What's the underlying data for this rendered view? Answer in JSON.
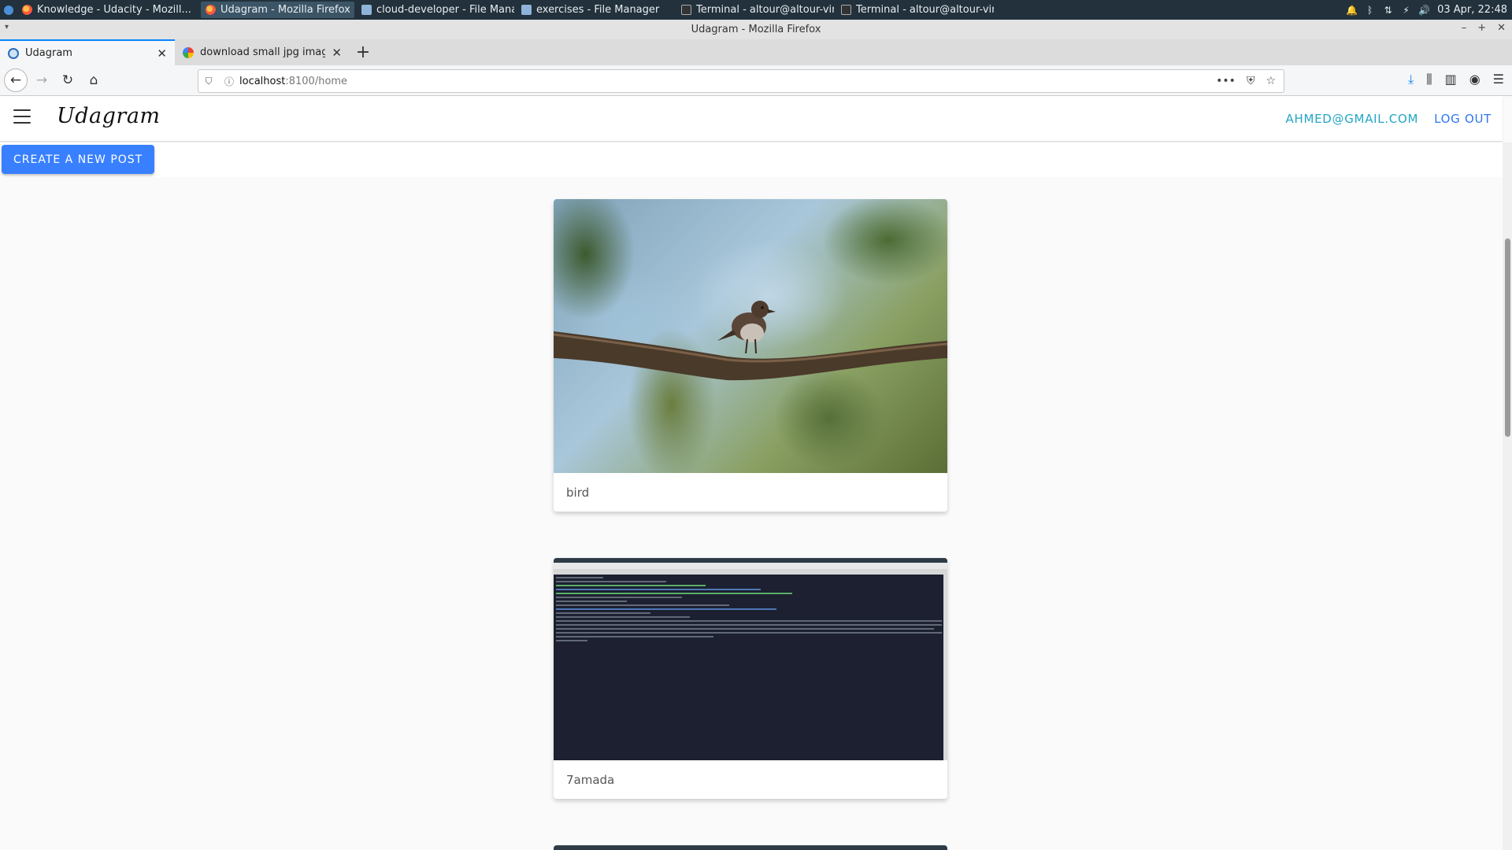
{
  "taskbar": {
    "tasks": [
      {
        "label": "Knowledge - Udacity - Mozill...",
        "icon": "firefox-icon"
      },
      {
        "label": "Udagram - Mozilla Firefox",
        "icon": "firefox-icon"
      },
      {
        "label": "cloud-developer - File Manag...",
        "icon": "folder-icon"
      },
      {
        "label": "exercises - File Manager",
        "icon": "folder-icon"
      },
      {
        "label": "Terminal - altour@altour-virt...",
        "icon": "terminal-icon"
      },
      {
        "label": "Terminal - altour@altour-virt...",
        "icon": "terminal-icon"
      }
    ],
    "clock": "03 Apr, 22:48"
  },
  "window": {
    "title": "Udagram - Mozilla Firefox"
  },
  "browser": {
    "tabs": [
      {
        "label": "Udagram",
        "selected": true
      },
      {
        "label": "download small jpg image - G",
        "selected": false
      }
    ],
    "url_host": "localhost",
    "url_path": ":8100/home"
  },
  "app": {
    "brand": "Udagram",
    "user_email": "AHMED@GMAIL.COM",
    "logout_label": "LOG OUT",
    "create_post_label": "CREATE A NEW POST",
    "accent_color": "#3880ff"
  },
  "feed": {
    "posts": [
      {
        "caption": "bird",
        "image": "bird-on-branch-photo"
      },
      {
        "caption": "7amada",
        "image": "terminal-screenshot"
      }
    ]
  }
}
